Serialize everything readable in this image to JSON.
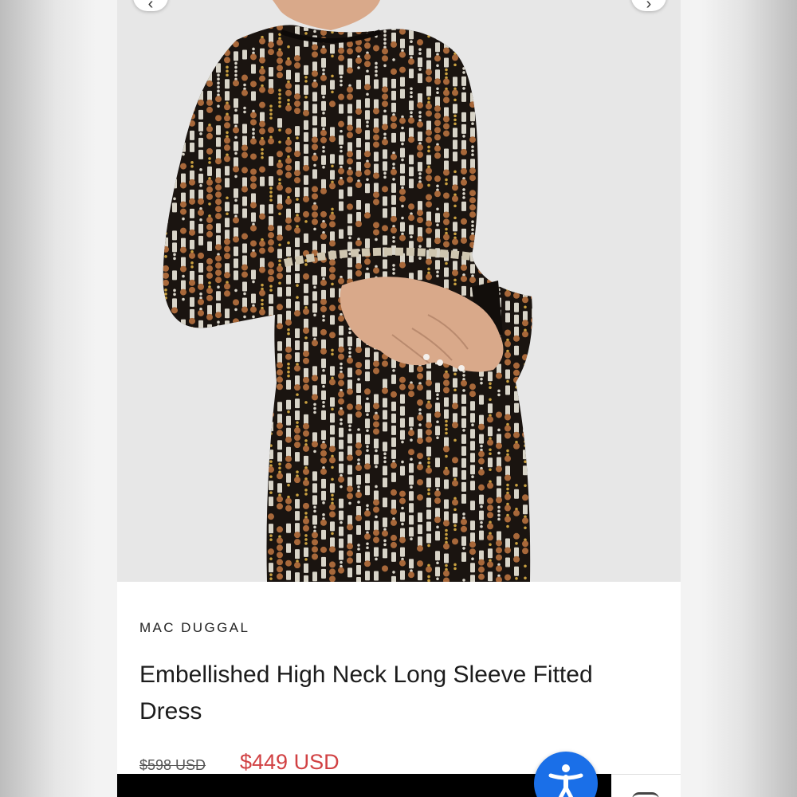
{
  "product": {
    "brand": "MAC DUGGAL",
    "title": "Embellished High Neck Long Sleeve Fitted Dress",
    "price_original": "$598 USD",
    "price_sale": "$449 USD"
  },
  "image": {
    "subject": "model wearing sequin embellished black dress",
    "colors": {
      "dress_base": "#1a1410",
      "bronze_sequin": "#a8683a",
      "gold_bead": "#c9a040",
      "silver_bead": "#d8d4c8"
    }
  },
  "icons": {
    "prev": "chevron-left-icon",
    "next": "chevron-right-icon",
    "accessibility": "accessibility-person-icon",
    "chat": "chat-icon"
  },
  "colors": {
    "sale_price": "#d14143",
    "accessibility_button": "#1a6fe8"
  }
}
